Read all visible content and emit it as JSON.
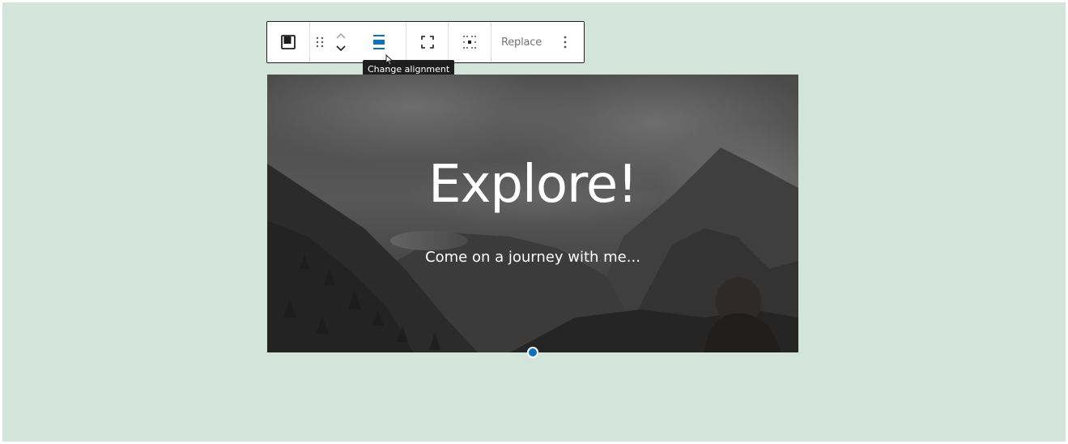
{
  "toolbar": {
    "block_type_icon": "cover-block-icon",
    "drag_icon": "drag-handle-icon",
    "move_up_icon": "chevron-up-icon",
    "move_down_icon": "chevron-down-icon",
    "align_icon": "align-center-icon",
    "fullscreen_icon": "full-height-icon",
    "position_icon": "content-position-icon",
    "replace_label": "Replace",
    "more_icon": "more-options-icon",
    "accent_color": "#0a72c2"
  },
  "tooltip": {
    "text": "Change alignment"
  },
  "cover": {
    "title": "Explore!",
    "subtitle": "Come on a journey with me..."
  },
  "colors": {
    "canvas_background": "#d3e4da",
    "handle": "#0a72c2"
  }
}
